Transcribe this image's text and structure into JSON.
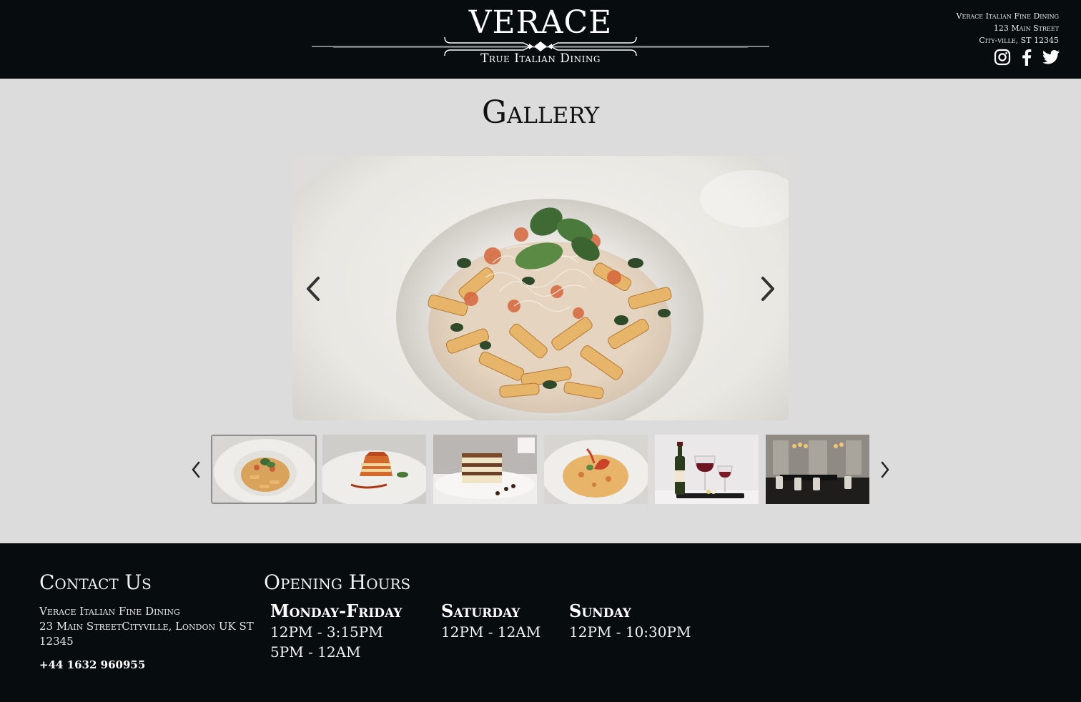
{
  "header": {
    "logo_title": "VERACE",
    "logo_subtitle": "True Italian Dining",
    "info_lines": [
      "Verace Italian Fine Dining",
      "123 Main Street",
      "City-ville, ST 12345"
    ],
    "social_icons": [
      "instagram-icon",
      "facebook-icon",
      "twitter-icon"
    ]
  },
  "gallery": {
    "title": "Gallery",
    "main_image": "penne pasta with basil and parmesan",
    "thumbnails": [
      {
        "subject": "penne pasta",
        "active": true
      },
      {
        "subject": "lasagna",
        "active": false
      },
      {
        "subject": "tiramisu",
        "active": false
      },
      {
        "subject": "lobster risotto",
        "active": false
      },
      {
        "subject": "wine and glasses",
        "active": false
      },
      {
        "subject": "dining room",
        "active": false
      }
    ]
  },
  "footer": {
    "contact": {
      "title": "Contact Us",
      "name": "Verace Italian Fine Dining",
      "address": "23 Main StreetCityville, London UK ST 12345",
      "phone": "+44 1632 960955"
    },
    "hours": {
      "title": "Opening Hours",
      "days": [
        {
          "day": "Monday-Friday",
          "times": [
            "12PM - 3:15PM",
            "5PM - 12AM"
          ]
        },
        {
          "day": "Saturday",
          "times": [
            "12PM - 12AM"
          ]
        },
        {
          "day": "Sunday",
          "times": [
            "12PM - 10:30PM"
          ]
        }
      ]
    }
  },
  "colors": {
    "dark": "#070d0f",
    "background": "#dcdcdc",
    "text_light": "#ffffff"
  }
}
